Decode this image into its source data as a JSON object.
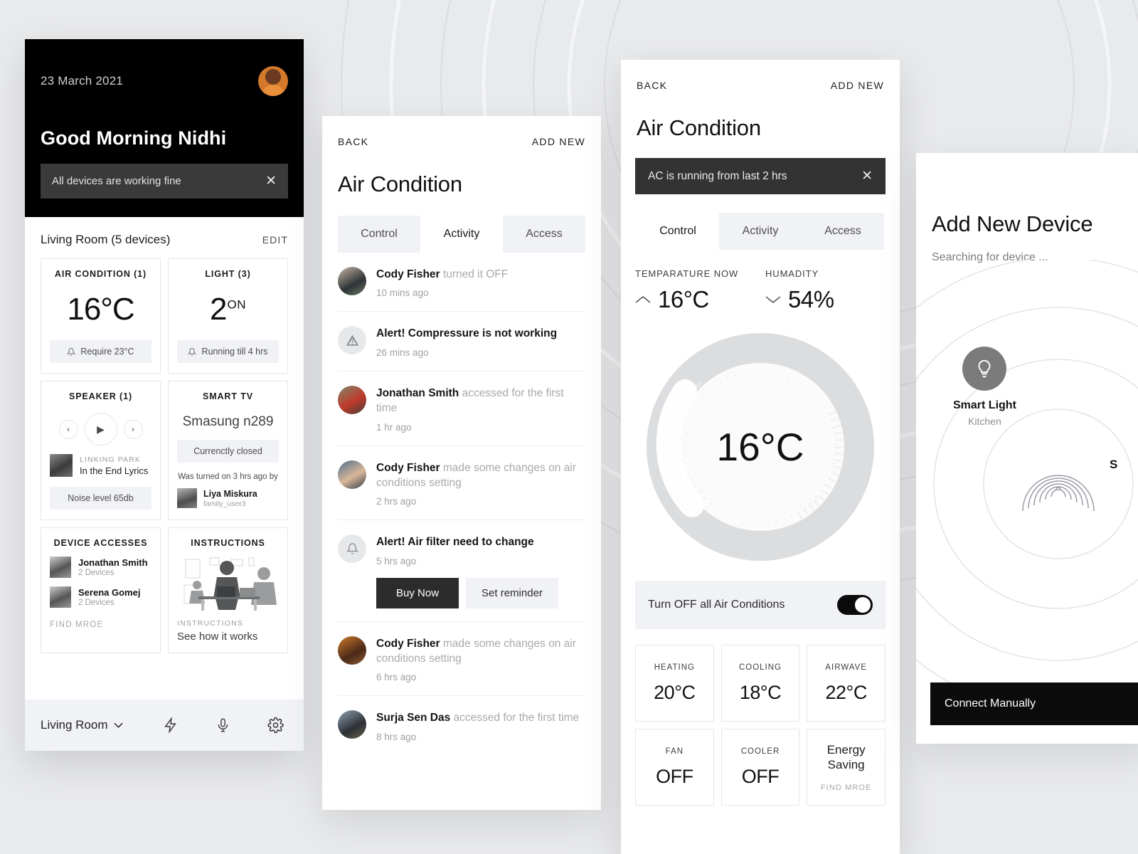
{
  "home": {
    "date": "23 March 2021",
    "greeting": "Good Morning Nidhi",
    "notice": "All devices are working fine",
    "close_icon": "close-icon",
    "avatar": "user-avatar",
    "room_title": "Living Room (5 devices)",
    "edit_label": "EDIT",
    "cards": {
      "ac": {
        "title": "AIR CONDITION (1)",
        "value": "16°C",
        "pill": "Require 23°C",
        "pill_icon": "bell-icon"
      },
      "light": {
        "title": "LIGHT (3)",
        "value": "2",
        "value_sup": "ON",
        "pill": "Running till 4 hrs",
        "pill_icon": "bell-icon"
      },
      "speaker": {
        "title": "SPEAKER (1)",
        "prev_icon": "previous-icon",
        "play_icon": "play-icon",
        "next_icon": "next-icon",
        "artist": "LINKING PARK",
        "track": "In the End Lyrics",
        "pill": "Noise level 65db"
      },
      "tv": {
        "title": "SMART TV",
        "model": "Smasung n289",
        "status": "Currenctly closed",
        "turned_on_by": "Was turned on 3 hrs ago by",
        "user_name": "Liya Miskura",
        "user_handle": "family_user3"
      },
      "accesses": {
        "title": "DEVICE ACCESSES",
        "people": [
          {
            "name": "Jonathan Smith",
            "devices": "2 Devices"
          },
          {
            "name": "Serena Gomej",
            "devices": "2 Devices"
          }
        ],
        "find_more": "FIND MROE"
      },
      "instructions": {
        "title": "INSTRUCTIONS",
        "label": "INSTRUCTIONS",
        "link": "See how it works",
        "illustration": "people-at-desk-illustration"
      }
    },
    "nav": {
      "room": "Living Room",
      "chevron_icon": "chevron-down-icon",
      "icons": [
        "bolt-icon",
        "microphone-icon",
        "gear-icon"
      ]
    }
  },
  "activity": {
    "back": "BACK",
    "add_new": "ADD NEW",
    "title": "Air Condition",
    "tabs": [
      {
        "label": "Control",
        "active": false
      },
      {
        "label": "Activity",
        "active": true
      },
      {
        "label": "Access",
        "active": false
      }
    ],
    "items": [
      {
        "actor": "Cody Fisher",
        "action": "turned it OFF",
        "time": "10 mins ago",
        "avatar": "avatar-photo"
      },
      {
        "actor": "",
        "action": "Alert! Compressure is not working",
        "time": "26 mins ago",
        "avatar": "warning-icon"
      },
      {
        "actor": "Jonathan Smith",
        "action": "accessed for the first time",
        "time": "1 hr ago",
        "avatar": "avatar-photo"
      },
      {
        "actor": "Cody Fisher",
        "action": "made some changes on air conditions setting",
        "time": "2 hrs ago",
        "avatar": "avatar-photo"
      },
      {
        "actor": "",
        "action": "Alert! Air filter need to change",
        "time": "5 hrs ago",
        "avatar": "bell-icon",
        "buttons": [
          "Buy Now",
          "Set reminder"
        ]
      },
      {
        "actor": "Cody Fisher",
        "action": "made some changes on air conditions setting",
        "time": "6 hrs ago",
        "avatar": "avatar-photo"
      },
      {
        "actor": "Surja Sen Das",
        "action": "accessed for the first time",
        "time": "8 hrs ago",
        "avatar": "avatar-photo"
      }
    ]
  },
  "control": {
    "back": "BACK",
    "add_new": "ADD NEW",
    "title": "Air Condition",
    "alert": "AC is running from last 2 hrs",
    "close_icon": "close-icon",
    "tabs": [
      {
        "label": "Control",
        "active": true
      },
      {
        "label": "Activity",
        "active": false
      },
      {
        "label": "Access",
        "active": false
      }
    ],
    "temperature": {
      "caption": "TEMPARATURE NOW",
      "value": "16°C",
      "icon": "chevron-up-icon"
    },
    "humidity": {
      "caption": "HUMADITY",
      "value": "54%",
      "icon": "chevron-down-icon"
    },
    "dial_value": "16°C",
    "toggle": {
      "label": "Turn OFF all Air Conditions",
      "state": "on"
    },
    "modes": [
      {
        "caption": "HEATING",
        "value": "20°C"
      },
      {
        "caption": "COOLING",
        "value": "18°C"
      },
      {
        "caption": "AIRWAVE",
        "value": "22°C"
      },
      {
        "caption": "FAN",
        "value": "OFF"
      },
      {
        "caption": "COOLER",
        "value": "OFF"
      },
      {
        "caption": "Energy Saving",
        "value": "",
        "sub": "FIND MROE",
        "big": true
      }
    ]
  },
  "add_device": {
    "title": "Add New Device",
    "subtitle": "Searching for device ...",
    "found": {
      "name": "Smart Light",
      "room": "Kitchen",
      "icon": "lightbulb-icon"
    },
    "radar_icon": "signal-waves-icon",
    "edge_text": "S",
    "connect_label": "Connect Manually"
  },
  "colors": {
    "accent": "#000000",
    "surface": "#ffffff",
    "muted": "#f1f2f6",
    "background": "#e9eaec"
  }
}
